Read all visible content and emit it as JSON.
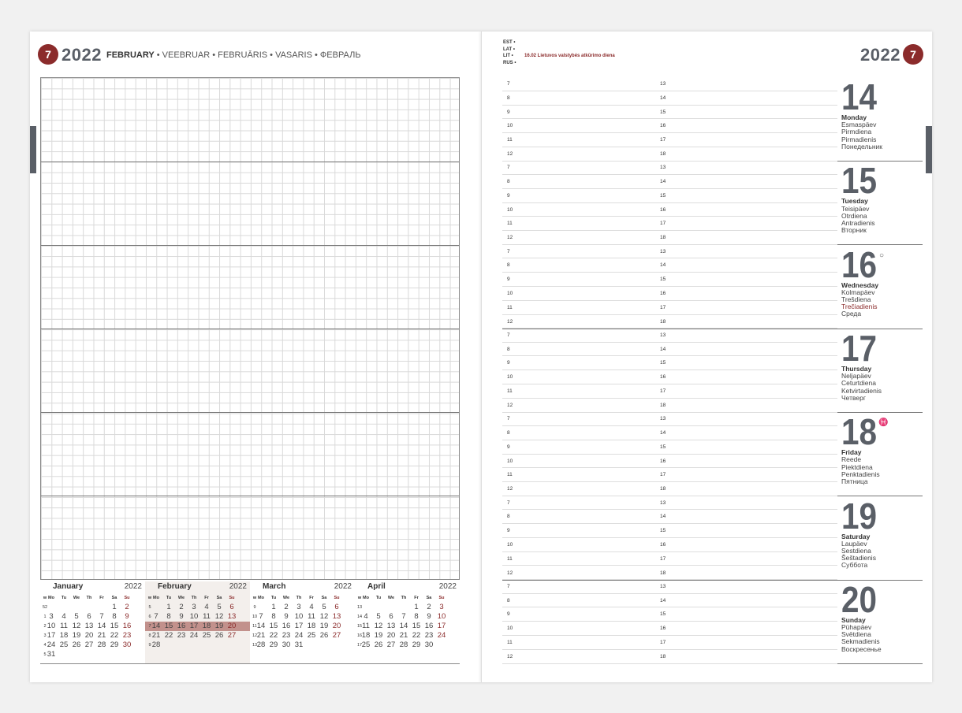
{
  "left": {
    "week": "7",
    "year": "2022",
    "month_en": "FEBRUARY",
    "month_rest": " • VEEBRUAR • FEBRUĀRIS • VASARIS • ФЕВРАЛЬ"
  },
  "right": {
    "week": "7",
    "year": "2022",
    "lang_codes": [
      "EST •",
      "LAT •",
      "LIT •",
      "RUS •"
    ],
    "holiday_date": "16.02",
    "holiday_text": " Lietuvos valstybės atkūrimo diena"
  },
  "hours_left": [
    "7",
    "8",
    "9",
    "10",
    "11",
    "12"
  ],
  "hours_right": [
    "13",
    "14",
    "15",
    "16",
    "17",
    "18"
  ],
  "days": [
    {
      "num": "14",
      "names": [
        "Monday",
        "Esmaspäev",
        "Pirmdiena",
        "Pirmadienis",
        "Понедельник"
      ],
      "red": [],
      "icon": ""
    },
    {
      "num": "15",
      "names": [
        "Tuesday",
        "Teisipäev",
        "Otrdiena",
        "Antradienis",
        "Вторник"
      ],
      "red": [],
      "icon": ""
    },
    {
      "num": "16",
      "names": [
        "Wednesday",
        "Kolmapäev",
        "Trešdiena",
        "Trečiadienis",
        "Среда"
      ],
      "red": [
        3
      ],
      "icon": "○"
    },
    {
      "num": "17",
      "names": [
        "Thursday",
        "Neljapäev",
        "Ceturtdiena",
        "Ketvirtadienis",
        "Четверг"
      ],
      "red": [],
      "icon": ""
    },
    {
      "num": "18",
      "names": [
        "Friday",
        "Reede",
        "Piektdiena",
        "Penktadienis",
        "Пятница"
      ],
      "red": [],
      "icon": "♓"
    },
    {
      "num": "19",
      "names": [
        "Saturday",
        "Laupäev",
        "Sestdiena",
        "Šeštadienis",
        "Суббота"
      ],
      "red": [],
      "icon": ""
    },
    {
      "num": "20",
      "names": [
        "Sunday",
        "Pühapäev",
        "Svētdiena",
        "Sekmadienis",
        "Воскресенье"
      ],
      "red": [],
      "icon": ""
    }
  ],
  "dow": [
    "w",
    "Mo",
    "Tu",
    "We",
    "Th",
    "Fr",
    "Sa",
    "Su"
  ],
  "mini_calendars": [
    {
      "name": "January",
      "year": "2022",
      "highlight": false,
      "band_row": -1,
      "rows": [
        [
          "52",
          "",
          "",
          "",
          "",
          "",
          "1",
          "2"
        ],
        [
          "1",
          "3",
          "4",
          "5",
          "6",
          "7",
          "8",
          "9"
        ],
        [
          "2",
          "10",
          "11",
          "12",
          "13",
          "14",
          "15",
          "16"
        ],
        [
          "3",
          "17",
          "18",
          "19",
          "20",
          "21",
          "22",
          "23"
        ],
        [
          "4",
          "24",
          "25",
          "26",
          "27",
          "28",
          "29",
          "30"
        ],
        [
          "5",
          "31",
          "",
          "",
          "",
          "",
          "",
          ""
        ]
      ]
    },
    {
      "name": "February",
      "year": "2022",
      "highlight": true,
      "band_row": 2,
      "rows": [
        [
          "5",
          "",
          "1",
          "2",
          "3",
          "4",
          "5",
          "6"
        ],
        [
          "6",
          "7",
          "8",
          "9",
          "10",
          "11",
          "12",
          "13"
        ],
        [
          "7",
          "14",
          "15",
          "16",
          "17",
          "18",
          "19",
          "20"
        ],
        [
          "8",
          "21",
          "22",
          "23",
          "24",
          "25",
          "26",
          "27"
        ],
        [
          "9",
          "28",
          "",
          "",
          "",
          "",
          "",
          ""
        ]
      ]
    },
    {
      "name": "March",
      "year": "2022",
      "highlight": false,
      "band_row": -1,
      "rows": [
        [
          "9",
          "",
          "1",
          "2",
          "3",
          "4",
          "5",
          "6"
        ],
        [
          "10",
          "7",
          "8",
          "9",
          "10",
          "11",
          "12",
          "13"
        ],
        [
          "11",
          "14",
          "15",
          "16",
          "17",
          "18",
          "19",
          "20"
        ],
        [
          "12",
          "21",
          "22",
          "23",
          "24",
          "25",
          "26",
          "27"
        ],
        [
          "13",
          "28",
          "29",
          "30",
          "31",
          "",
          "",
          ""
        ]
      ]
    },
    {
      "name": "April",
      "year": "2022",
      "highlight": false,
      "band_row": -1,
      "rows": [
        [
          "13",
          "",
          "",
          "",
          "",
          "1",
          "2",
          "3"
        ],
        [
          "14",
          "4",
          "5",
          "6",
          "7",
          "8",
          "9",
          "10"
        ],
        [
          "15",
          "11",
          "12",
          "13",
          "14",
          "15",
          "16",
          "17"
        ],
        [
          "16",
          "18",
          "19",
          "20",
          "21",
          "22",
          "23",
          "24"
        ],
        [
          "17",
          "25",
          "26",
          "27",
          "28",
          "29",
          "30",
          ""
        ]
      ]
    }
  ],
  "colors": {
    "accent": "#8b2b2b",
    "title_gray": "#5a5f67",
    "week_band": "#c2918c",
    "month_bg": "#f3efec"
  }
}
